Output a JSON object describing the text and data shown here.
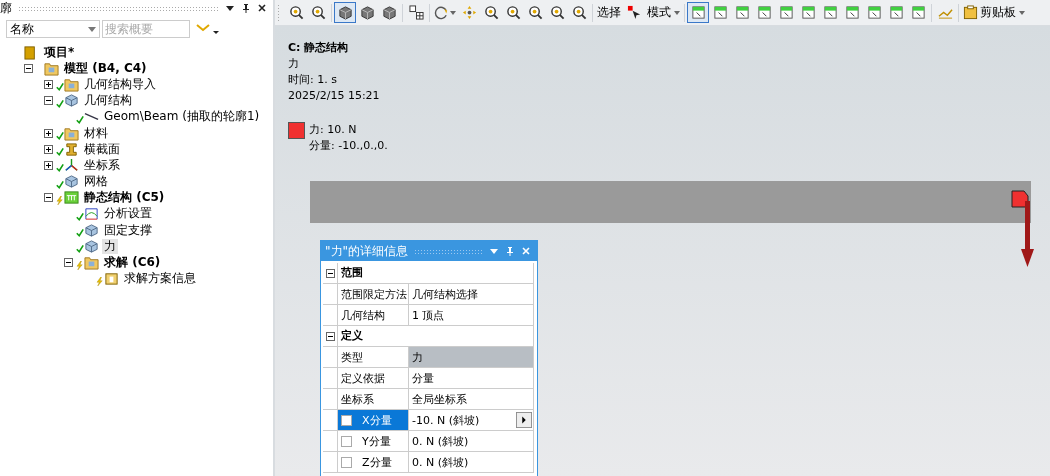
{
  "outline_panel": {
    "title": "廓",
    "filter": {
      "value": "名称"
    },
    "search": {
      "placeholder": "搜索概要"
    }
  },
  "tree": {
    "items": [
      {
        "label": "项目*",
        "bold": true,
        "selected": false,
        "children": [
          {
            "label": "模型 (B4, C4)",
            "bold": true,
            "selected": false,
            "expanded": true,
            "children": [
              {
                "label": "几何结构导入",
                "bold": false,
                "selected": false,
                "expanded": false,
                "done": true
              },
              {
                "label": "几何结构",
                "bold": false,
                "selected": false,
                "expanded": true,
                "done": true,
                "children": [
                  {
                    "label": "Geom\\Beam (抽取的轮廓1)",
                    "bold": false,
                    "selected": false,
                    "done": true
                  }
                ]
              },
              {
                "label": "材料",
                "bold": false,
                "selected": false,
                "expanded": false,
                "done": true
              },
              {
                "label": "横截面",
                "bold": false,
                "selected": false,
                "expanded": false,
                "done": true
              },
              {
                "label": "坐标系",
                "bold": false,
                "selected": false,
                "expanded": false,
                "done": true
              },
              {
                "label": "网格",
                "bold": false,
                "selected": false,
                "done": true
              },
              {
                "label": "静态结构 (C5)",
                "bold": true,
                "selected": false,
                "expanded": true,
                "done": false,
                "children": [
                  {
                    "label": "分析设置",
                    "bold": false,
                    "selected": false,
                    "done": true
                  },
                  {
                    "label": "固定支撑",
                    "bold": false,
                    "selected": false,
                    "done": true
                  },
                  {
                    "label": "力",
                    "bold": false,
                    "selected": true,
                    "done": true
                  },
                  {
                    "label": "求解 (C6)",
                    "bold": true,
                    "selected": false,
                    "expanded": true,
                    "done": false,
                    "children": [
                      {
                        "label": "求解方案信息",
                        "bold": false,
                        "selected": false,
                        "done": false
                      }
                    ]
                  }
                ]
              }
            ]
          }
        ]
      }
    ]
  },
  "toolbar": [
    {
      "kind": "icon",
      "pressed": false
    },
    {
      "kind": "icon",
      "pressed": false
    },
    {
      "kind": "separator"
    },
    {
      "kind": "icon",
      "pressed": true
    },
    {
      "kind": "icon",
      "pressed": false
    },
    {
      "kind": "icon",
      "pressed": false
    },
    {
      "kind": "separator"
    },
    {
      "kind": "icon",
      "pressed": false
    },
    {
      "kind": "separator"
    },
    {
      "kind": "icon",
      "pressed": false,
      "dropdown": true
    },
    {
      "kind": "icon",
      "pressed": false
    },
    {
      "kind": "icon",
      "pressed": false
    },
    {
      "kind": "icon",
      "pressed": false
    },
    {
      "kind": "icon",
      "pressed": false
    },
    {
      "kind": "icon",
      "pressed": false
    },
    {
      "kind": "icon",
      "pressed": false
    },
    {
      "kind": "separator"
    },
    {
      "kind": "text",
      "label": "选择"
    },
    {
      "kind": "icon",
      "pressed": false
    },
    {
      "kind": "text",
      "label": "模式",
      "dropdown": true
    },
    {
      "kind": "separator"
    },
    {
      "kind": "icon",
      "pressed": true
    },
    {
      "kind": "icon",
      "pressed": false
    },
    {
      "kind": "icon",
      "pressed": false
    },
    {
      "kind": "icon",
      "pressed": false
    },
    {
      "kind": "icon",
      "pressed": false
    },
    {
      "kind": "icon",
      "pressed": false
    },
    {
      "kind": "icon",
      "pressed": false
    },
    {
      "kind": "icon",
      "pressed": false
    },
    {
      "kind": "icon",
      "pressed": false
    },
    {
      "kind": "icon",
      "pressed": false
    },
    {
      "kind": "icon",
      "pressed": false
    },
    {
      "kind": "separator"
    },
    {
      "kind": "icon",
      "pressed": false
    },
    {
      "kind": "separator"
    },
    {
      "kind": "icon_text",
      "label": "剪贴板",
      "dropdown": true
    }
  ],
  "viewport": {
    "info": {
      "title": "C: 静态结构",
      "lines": [
        "力",
        "时间: 1. s",
        "2025/2/15 15:21"
      ]
    },
    "legend": {
      "color": "#f03030",
      "lines": [
        "力: 10. N",
        "分量: -10.,0.,0."
      ]
    }
  },
  "details": {
    "title": "\"力\"的详细信息",
    "rows": [
      {
        "kind": "group",
        "label": "范围",
        "expanded": true
      },
      {
        "kind": "prop",
        "label": "范围限定方法",
        "value": "几何结构选择",
        "selected": false,
        "shaded": false
      },
      {
        "kind": "prop",
        "label": "几何结构",
        "value": "1 顶点",
        "selected": false,
        "shaded": false
      },
      {
        "kind": "group",
        "label": "定义",
        "expanded": true
      },
      {
        "kind": "prop",
        "label": "类型",
        "value": "力",
        "selected": false,
        "shaded": true
      },
      {
        "kind": "prop",
        "label": "定义依据",
        "value": "分量",
        "selected": false,
        "shaded": false
      },
      {
        "kind": "prop",
        "label": "坐标系",
        "value": "全局坐标系",
        "selected": false,
        "shaded": false
      },
      {
        "kind": "prop",
        "label": "X分量",
        "value": "-10. N  (斜坡)",
        "selected": true,
        "shaded": false,
        "checked": false
      },
      {
        "kind": "prop",
        "label": "Y分量",
        "value": "0. N  (斜坡)",
        "selected": false,
        "shaded": false,
        "checked": false
      },
      {
        "kind": "prop",
        "label": "Z分量",
        "value": "0. N  (斜坡)",
        "selected": false,
        "shaded": false,
        "checked": false
      }
    ]
  }
}
